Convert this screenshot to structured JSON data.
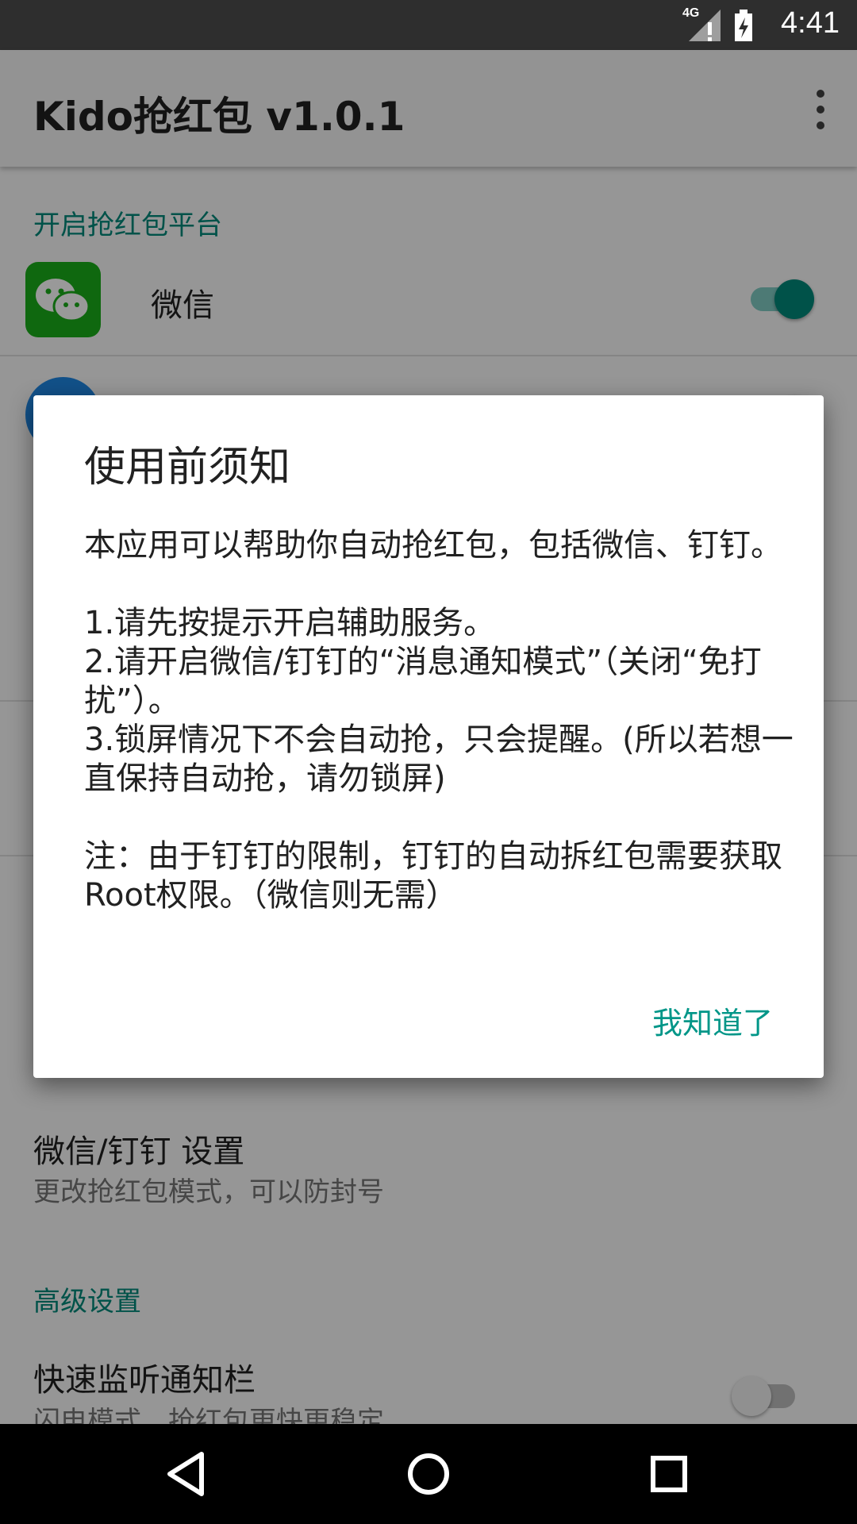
{
  "status_bar": {
    "network": "4G",
    "time": "4:41"
  },
  "app_bar": {
    "title": "Kido抢红包 v1.0.1"
  },
  "sections": {
    "platforms_header": "开启抢红包平台",
    "wechat_label": "微信",
    "wechat_enabled": true,
    "dingtalk_enabled": true,
    "settings_item_title": "微信/钉钉 设置",
    "settings_item_sub": "更改抢红包模式，可以防封号",
    "advanced_header": "高级设置",
    "fast_listen_title": "快速监听通知栏",
    "fast_listen_sub": "闪电模式，抢红包更快更稳定",
    "fast_listen_enabled": false
  },
  "dialog": {
    "title": "使用前须知",
    "body": "本应用可以帮助你自动抢红包，包括微信、钉钉。\n\n1.请先按提示开启辅助服务。\n2.请开启微信/钉钉的“消息通知模式”（关闭“免打扰”）。\n3.锁屏情况下不会自动抢，只会提醒。(所以若想一直保持自动抢，请勿锁屏)\n\n注：由于钉钉的限制，钉钉的自动拆红包需要获取Root权限。（微信则无需）",
    "confirm_label": "我知道了"
  },
  "colors": {
    "accent": "#00897b",
    "status_bar": "#2e2e2e",
    "wechat": "#1aad19"
  },
  "icons": [
    "network-4g-icon",
    "battery-icon",
    "overflow-menu-icon",
    "wechat-icon",
    "dingtalk-icon",
    "back-icon",
    "home-icon",
    "recents-icon"
  ]
}
